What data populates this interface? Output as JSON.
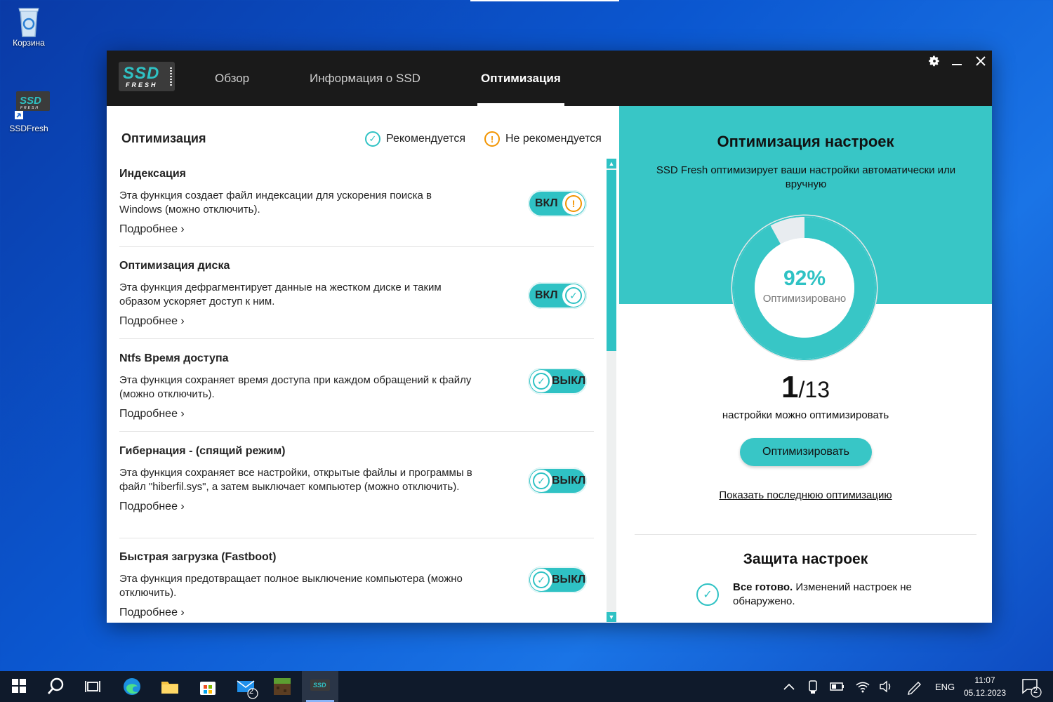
{
  "desktop": {
    "icons": [
      {
        "label": "Корзина"
      },
      {
        "label": "SSDFresh"
      }
    ]
  },
  "app": {
    "logo_main": "SSD",
    "logo_sub": "FRESH",
    "tabs": [
      {
        "label": "Обзор"
      },
      {
        "label": "Информация о SSD"
      },
      {
        "label": "Оптимизация"
      }
    ],
    "active_tab": "Оптимизация"
  },
  "left": {
    "title": "Оптимизация",
    "legend_recommended": "Рекомендуется",
    "legend_not_recommended": "Не рекомендуется",
    "more_label": "Подробнее",
    "items": [
      {
        "title": "Индексация",
        "desc": "Эта функция создает файл индексации для ускорения поиска в Windows (можно отключить).",
        "state": "ВКЛ",
        "status": "warn"
      },
      {
        "title": "Оптимизация диска",
        "desc": "Эта функция дефрагментирует данные на жестком диске и таким образом ускоряет доступ к ним.",
        "state": "ВКЛ",
        "status": "ok"
      },
      {
        "title": "Ntfs Время доступа",
        "desc": "Эта функция сохраняет время доступа при каждом обращений к файлу (можно отключить).",
        "state": "ВЫКЛ",
        "status": "ok"
      },
      {
        "title": "Гибернация - (спящий режим)",
        "desc": "Эта функция сохраняет все настройки, открытые файлы и программы в файл \"hiberfil.sys\", а затем выключает компьютер (можно отключить).",
        "state": "ВЫКЛ",
        "status": "ok"
      },
      {
        "title": "Быстрая загрузка (Fastboot)",
        "desc": "Эта функция предотвращает полное выключение компьютера (можно отключить).",
        "state": "ВЫКЛ",
        "status": "ok"
      }
    ]
  },
  "right": {
    "title": "Оптимизация настроек",
    "subtitle": "SSD Fresh оптимизирует ваши настройки автоматически или вручную",
    "percent": 92,
    "percent_text": "92%",
    "percent_label": "Оптимизировано",
    "optimizable_count": "1",
    "total_text": "/13",
    "count_label": "настройки можно оптимизировать",
    "optimize_button": "Оптимизировать",
    "last_link": "Показать последнюю оптимизацию",
    "protection_title": "Защита настроек",
    "protection_bold": "Все готово.",
    "protection_text": " Изменений настроек не обнаружено."
  },
  "taskbar": {
    "mail_badge": "2",
    "lang": "ENG",
    "time": "11:07",
    "date": "05.12.2023",
    "notif_badge": "2"
  },
  "colors": {
    "accent": "#38c6c6",
    "warn": "#f29400",
    "titlebar": "#1a1a1a"
  }
}
